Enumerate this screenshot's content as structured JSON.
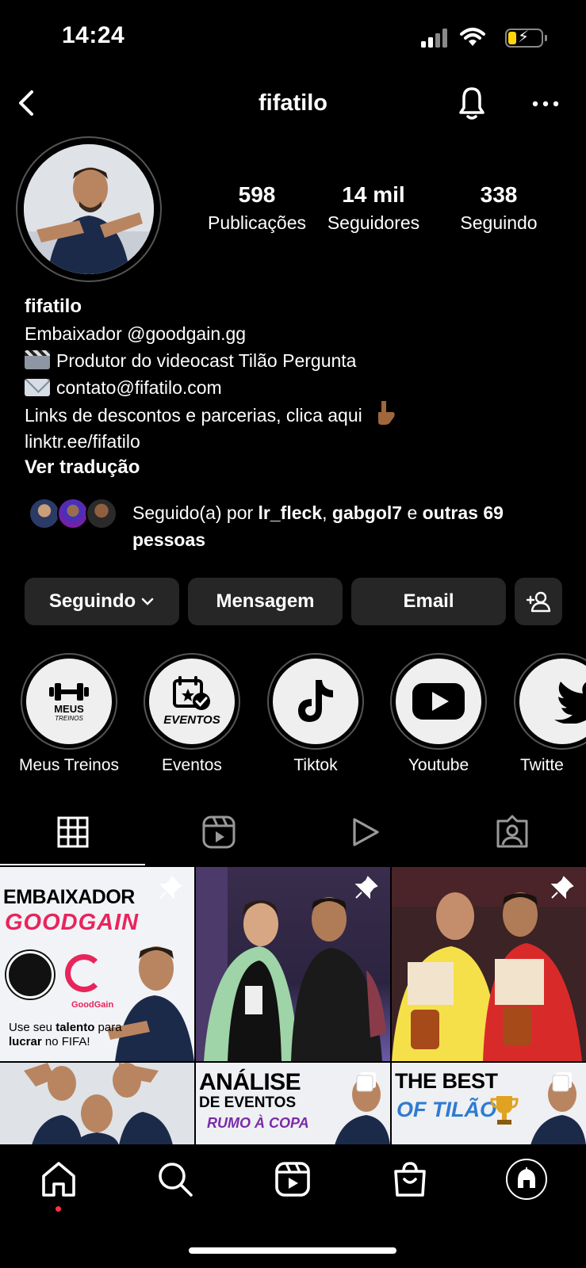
{
  "status_bar": {
    "time": "14:24"
  },
  "header": {
    "username_title": "fifatilo"
  },
  "stats": [
    {
      "number": "598",
      "label": "Publicações"
    },
    {
      "number": "14 mil",
      "label": "Seguidores"
    },
    {
      "number": "338",
      "label": "Seguindo"
    }
  ],
  "bio": {
    "name": "fifatilo",
    "line1": "Embaixador @goodgain.gg",
    "line2": "Produtor do videocast Tilão Pergunta",
    "line3": "contato@fifatilo.com",
    "line4": "Links de descontos e parcerias, clica aqui",
    "link": "linktr.ee/fifatilo",
    "translate": "Ver tradução"
  },
  "followed_by": {
    "prefix": "Seguido(a) por",
    "user1": "lr_fleck",
    "sep": ",",
    "user2": "gabgol7",
    "and": "e",
    "others": "outras 69 pessoas"
  },
  "buttons": {
    "following": "Seguindo",
    "message": "Mensagem",
    "email": "Email"
  },
  "highlights": [
    {
      "label": "Meus Treinos",
      "icon": "dumbbell-icon",
      "caption": "MEUS",
      "caption2": "TREINOS"
    },
    {
      "label": "Eventos",
      "icon": "calendar-check-icon",
      "caption": "EVENTOS"
    },
    {
      "label": "Tiktok",
      "icon": "tiktok-icon"
    },
    {
      "label": "Youtube",
      "icon": "youtube-icon"
    },
    {
      "label": "Twitte",
      "icon": "twitter-icon"
    }
  ],
  "posts": {
    "p1": {
      "line1": "EMBAIXADOR",
      "line2": "GOODGAIN",
      "brand": "GoodGain",
      "cta_a": "Use seu",
      "cta_b": "talento",
      "cta_c": "para",
      "cta_d": "lucrar",
      "cta_e": "no FIFA!"
    },
    "p5": {
      "line1": "ANÁLISE",
      "line2": "DE EVENTOS",
      "line3": "RUMO À COPA"
    },
    "p6": {
      "line1": "THE BEST",
      "line2": "OF TILÃO"
    }
  },
  "colors": {
    "background": "#000000",
    "button": "#262626",
    "accent_red": "#ff3040",
    "battery": "#ffd60a"
  }
}
